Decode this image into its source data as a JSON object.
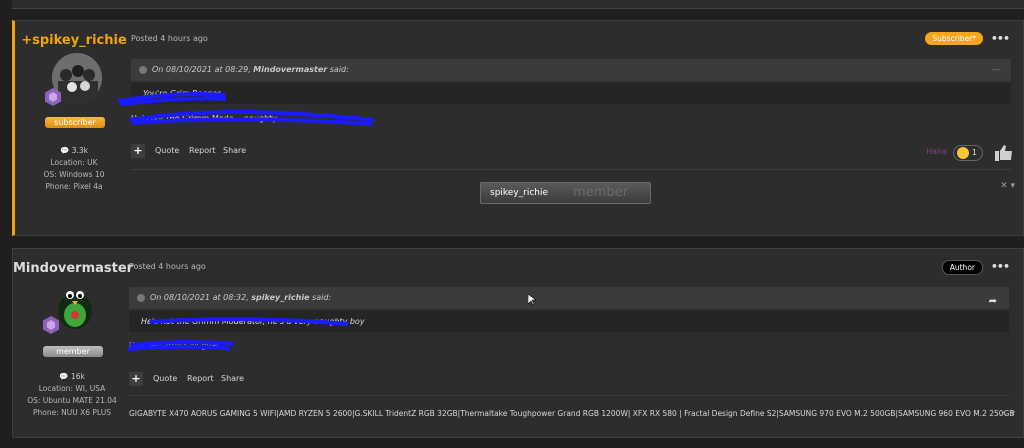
{
  "posts": [
    {
      "author": "+spikey_richie",
      "posted": "Posted 4 hours ago",
      "badge": "Subscriber*",
      "group": "subscriber",
      "reputation": "3.3k",
      "location": "Location: UK",
      "os": "OS: Windows 10",
      "phone": "Phone: Pixel 4a",
      "quote_prefix": "On 08/10/2021 at 08:29, ",
      "quote_author": "Mindovermaster",
      "quote_suffix": " said:",
      "quote_text": "You're Grim Reaper",
      "reply_text": "He's not the Grimm Mode... naughty...",
      "actions": {
        "quote": "Quote",
        "report": "Report",
        "share": "Share"
      },
      "reaction_label": "Haha",
      "reaction_count": "1"
    },
    {
      "author": "Mindovermaster",
      "posted": "Posted 4 hours ago",
      "badge": "Author",
      "group": "member",
      "reputation": "16k",
      "location": "Location: WI, USA",
      "os": "OS: Ubuntu MATE 21.04",
      "phone": "Phone: NUU X6 PLUS",
      "quote_prefix": "On 08/10/2021 at 08:32, ",
      "quote_author": "spikey_richie",
      "quote_suffix": " said:",
      "quote_text": "He's not the Grimm Moderator, he's a very naughty boy",
      "reply_text": "Hell, we aren't all goat...",
      "actions": {
        "quote": "Quote",
        "report": "Report",
        "share": "Share"
      },
      "signature": "GIGABYTE X470 AORUS GAMING 5 WIFI|AMD RYZEN 5 2600|G.SKILL TridentZ RGB 32GB|Thermaltake Toughpower Grand RGB 1200W| XFX RX 580 | Fractal Design Define S2|SAMSUNG 970 EVO M.2 500GB|SAMSUNG 960 EVO M.2 250GB"
    }
  ],
  "hover_card": {
    "name": "spikey_richie",
    "group": "member"
  },
  "colors": {
    "accent": "#f0a30a",
    "reaction": "#8a3c8f",
    "scribble": "#1a1aff"
  },
  "icons": [
    "plus-icon",
    "more-icon",
    "quote-icon",
    "share-icon",
    "like-icon",
    "close-icon",
    "cursor-icon"
  ]
}
